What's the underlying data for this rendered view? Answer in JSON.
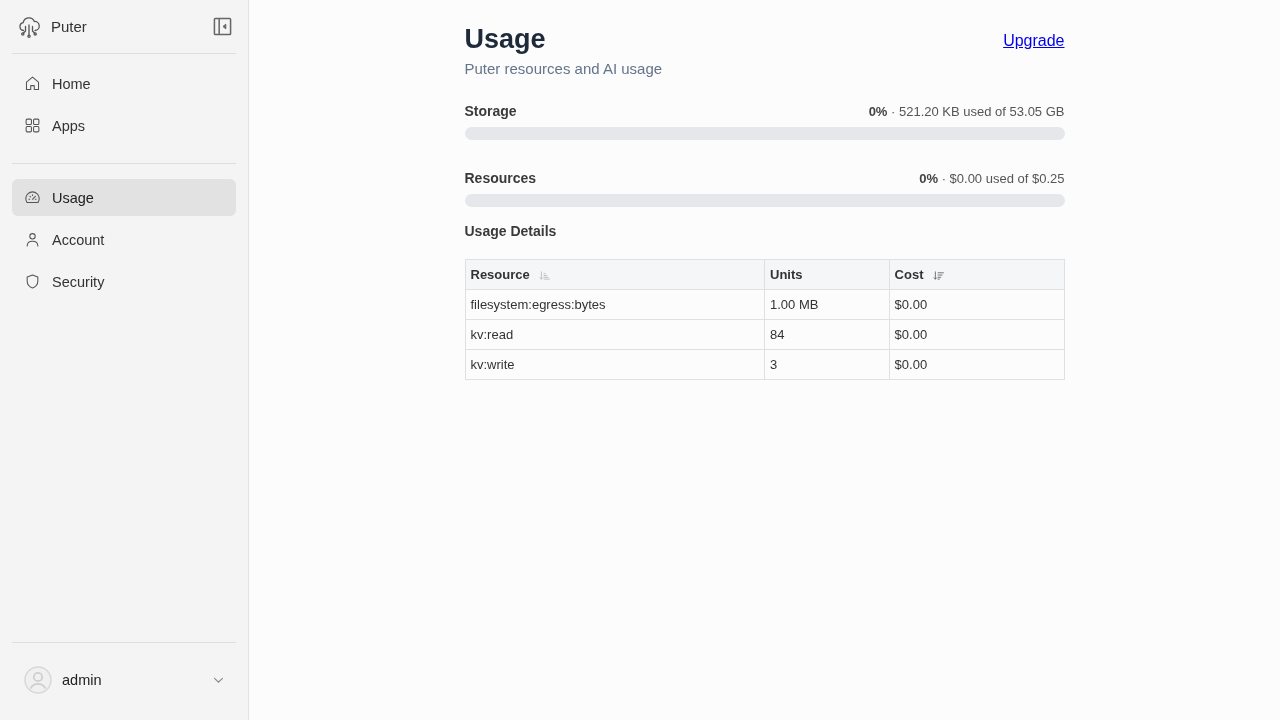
{
  "sidebar": {
    "brand": "Puter",
    "nav_groups": [
      [
        {
          "label": "Home",
          "selected": false
        },
        {
          "label": "Apps",
          "selected": false
        }
      ],
      [
        {
          "label": "Usage",
          "selected": true
        },
        {
          "label": "Account",
          "selected": false
        },
        {
          "label": "Security",
          "selected": false
        }
      ]
    ],
    "user": {
      "name": "admin"
    }
  },
  "page": {
    "title": "Usage",
    "subtitle": "Puter resources and AI usage",
    "upgrade_link": "Upgrade"
  },
  "meters": [
    {
      "label": "Storage",
      "reading": "**0%** · 521.20 KB used of 53.05 GB",
      "level": 0
    },
    {
      "label": "Resources",
      "reading": "**0%** · $0.00 used of $0.25",
      "level": 0
    }
  ],
  "usage_details": {
    "title": "Usage Details",
    "columns": [
      {
        "label": "Resource",
        "sortable": true,
        "sorted": false
      },
      {
        "label": "Units"
      },
      {
        "label": "Cost",
        "sortable": true,
        "sorted": true
      }
    ],
    "rows": [
      [
        "filesystem:egress:bytes",
        "1.00 MB",
        "$0.00"
      ],
      [
        "kv:read",
        "84",
        "$0.00"
      ],
      [
        "kv:write",
        "3",
        "$0.00"
      ]
    ]
  }
}
